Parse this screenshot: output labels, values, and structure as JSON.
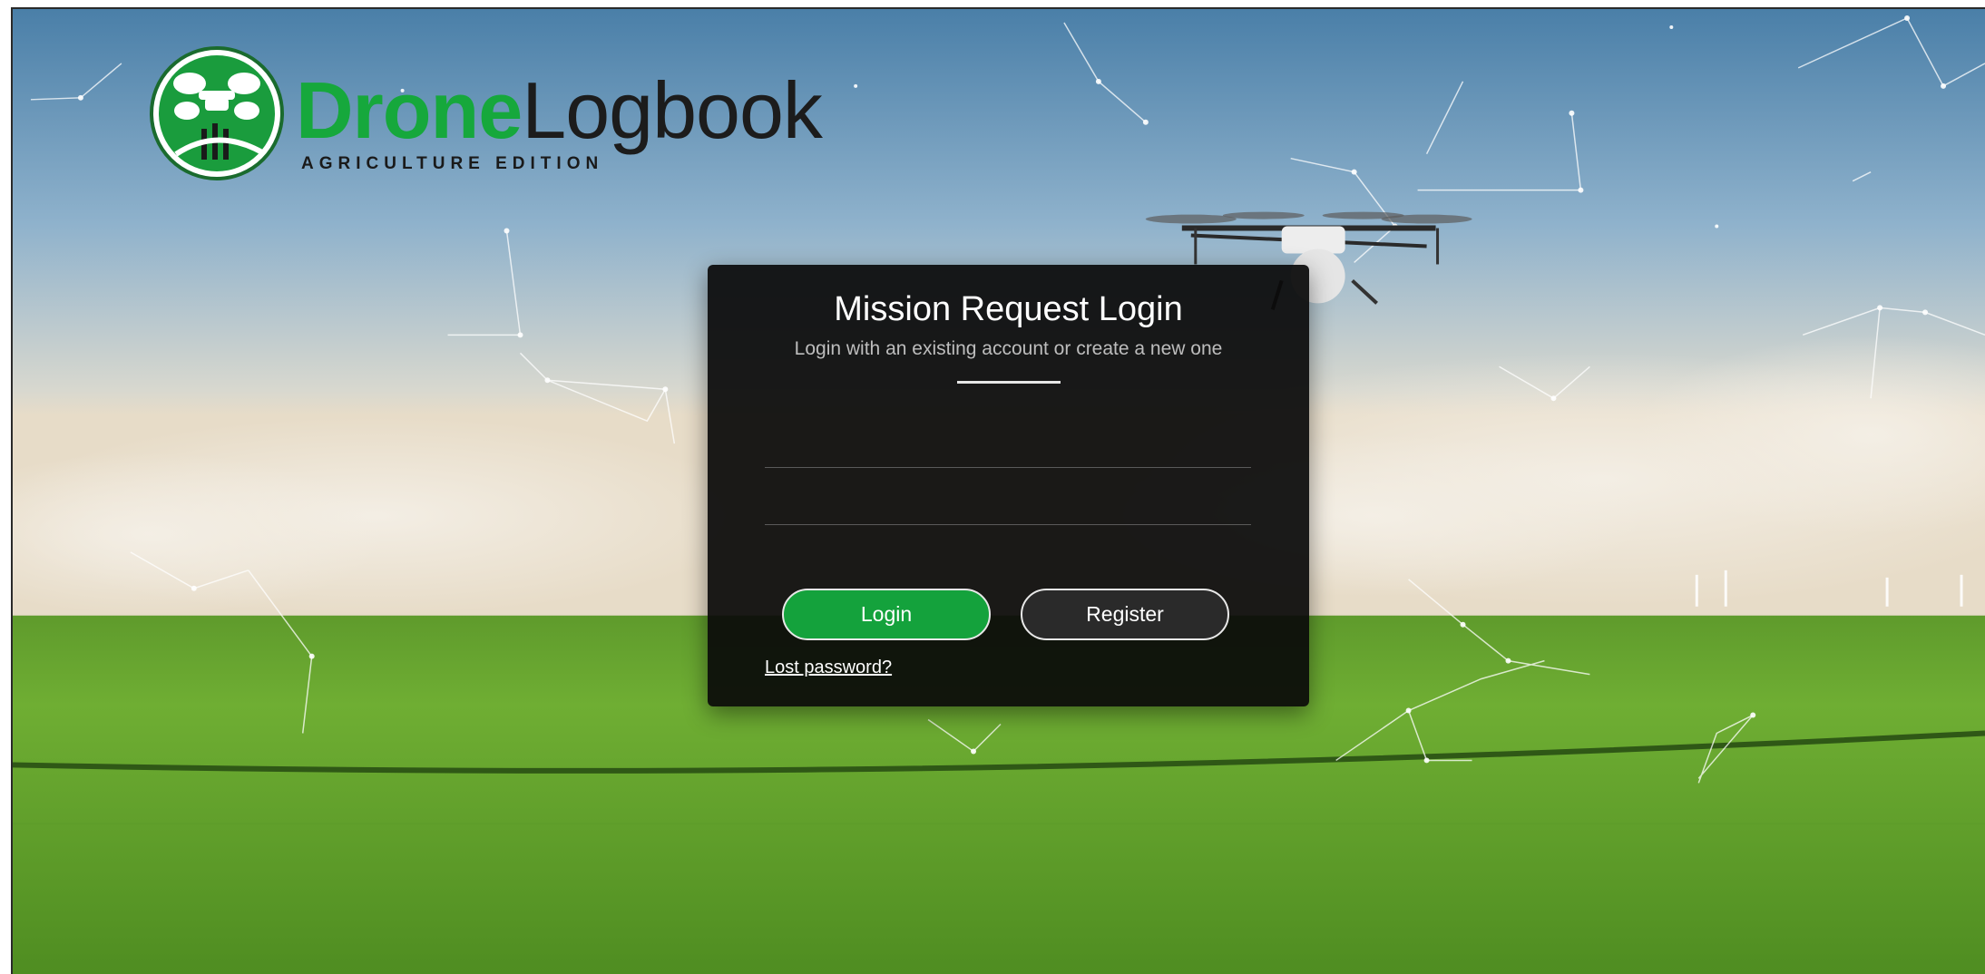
{
  "brand": {
    "word_strong": "Drone",
    "word_light": "Logbook",
    "edition": "AGRICULTURE EDITION"
  },
  "login_panel": {
    "title": "Mission Request Login",
    "subtitle": "Login with an existing account or create a new one",
    "username_field": {
      "value": "",
      "placeholder": ""
    },
    "password_field": {
      "value": "",
      "placeholder": ""
    },
    "login_button": "Login",
    "register_button": "Register",
    "lost_password_link": "Lost password?"
  },
  "colors": {
    "brand_green": "#16a83c",
    "button_green": "#14a23c",
    "panel_bg": "#0a0a0a",
    "register_bg": "#2a2a2a"
  },
  "icons": {
    "logo_emblem": "drone-field-emblem-icon",
    "drone": "agricultural-drone-icon"
  }
}
